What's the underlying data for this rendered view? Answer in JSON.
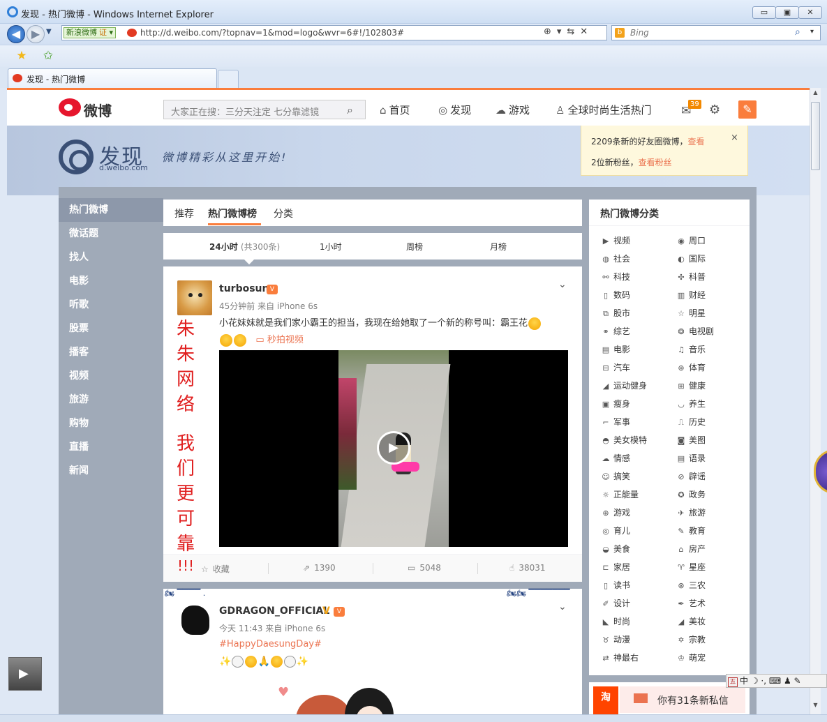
{
  "window": {
    "title": "发现 - 热门微博 - Windows Internet Explorer",
    "controls": {
      "minimize": "▭",
      "restore": "▣",
      "close": "✕"
    }
  },
  "address": {
    "site_tag": "新浪微博",
    "site_tag_cert": "证",
    "url": "http://d.weibo.com/?topnav=1&mod=logo&wvr=6#!/102803#",
    "icons": "⊕▾⇆✕"
  },
  "search": {
    "engine": "Bing",
    "go": "⌕",
    "menu": "▾"
  },
  "tabs": [
    {
      "label": "发现 - 热门微博"
    }
  ],
  "weibo": {
    "logo_text": "微博",
    "search_placeholder": "大家正在搜：三分天注定 七分靠滤镜",
    "nav": [
      {
        "label": "首页",
        "icon": "home-icon"
      },
      {
        "label": "发现",
        "icon": "compass-icon"
      },
      {
        "label": "游戏",
        "icon": "gamepad-icon"
      },
      {
        "label": "全球时尚生活热门",
        "icon": "user-icon"
      }
    ],
    "mail_count": "39"
  },
  "banner": {
    "title": "发现",
    "url": "d.weibo.com",
    "slogan": "微博精彩从这里开始!"
  },
  "notice": {
    "line1": "2209条新的好友圈微博，",
    "line1_link": "查看",
    "line2": "2位新粉丝，",
    "line2_link": "查看粉丝",
    "close": "×"
  },
  "left_nav": [
    {
      "label": "热门微博",
      "active": true
    },
    {
      "label": "微话题"
    },
    {
      "label": "找人"
    },
    {
      "label": "电影"
    },
    {
      "label": "听歌"
    },
    {
      "label": "股票"
    },
    {
      "label": "播客"
    },
    {
      "label": "视频"
    },
    {
      "label": "旅游"
    },
    {
      "label": "购物"
    },
    {
      "label": "直播"
    },
    {
      "label": "新闻"
    }
  ],
  "main_tabs": [
    {
      "label": "推荐"
    },
    {
      "label": "热门微博榜",
      "selected": true
    },
    {
      "label": "分类"
    }
  ],
  "rank_tabs": [
    {
      "label": "24小时",
      "count": "(共300条)",
      "selected": true
    },
    {
      "label": "1小时"
    },
    {
      "label": "周榜"
    },
    {
      "label": "月榜"
    }
  ],
  "post1": {
    "user": "turbosun",
    "meta": "45分钟前 来自 iPhone 6s",
    "text": "小花妹妹就是我们家小霸王的担当，我现在给她取了一个新的称号叫：霸王花",
    "video_link": "秒拍视频",
    "actions": [
      {
        "icon": "star-icon",
        "label": "收藏"
      },
      {
        "icon": "share-icon",
        "label": "1390"
      },
      {
        "icon": "comment-icon",
        "label": "5048"
      },
      {
        "icon": "like-icon",
        "label": "38031"
      }
    ]
  },
  "post2": {
    "user": "GDRAGON_OFFICIAL",
    "meta": "今天 11:43 来自 iPhone 6s",
    "tag": "#HappyDaesungDay#"
  },
  "overlay_text": {
    "line1": [
      "朱",
      "朱",
      "网",
      "络"
    ],
    "line2": [
      "我",
      "们",
      "更",
      "可",
      "靠"
    ],
    "bang": "!!!"
  },
  "right_panel": {
    "title": "热门微博分类",
    "categories": [
      {
        "label": "视频",
        "icon": "play-icon",
        "glyph": "▶"
      },
      {
        "label": "周口",
        "icon": "pin-icon",
        "glyph": "◉"
      },
      {
        "label": "社会",
        "icon": "globe-icon",
        "glyph": "◍"
      },
      {
        "label": "国际",
        "icon": "earth-icon",
        "glyph": "◐"
      },
      {
        "label": "科技",
        "icon": "link-icon",
        "glyph": "⚯"
      },
      {
        "label": "科普",
        "icon": "atom-icon",
        "glyph": "✣"
      },
      {
        "label": "数码",
        "icon": "device-icon",
        "glyph": "▯"
      },
      {
        "label": "财经",
        "icon": "bars-icon",
        "glyph": "▥"
      },
      {
        "label": "股市",
        "icon": "chart-icon",
        "glyph": "⧉"
      },
      {
        "label": "明星",
        "icon": "star-icon",
        "glyph": "☆"
      },
      {
        "label": "综艺",
        "icon": "mask-icon",
        "glyph": "⚭"
      },
      {
        "label": "电视剧",
        "icon": "film-reel-icon",
        "glyph": "❂"
      },
      {
        "label": "电影",
        "icon": "clapper-icon",
        "glyph": "▤"
      },
      {
        "label": "音乐",
        "icon": "music-icon",
        "glyph": "♫"
      },
      {
        "label": "汽车",
        "icon": "car-icon",
        "glyph": "⊟"
      },
      {
        "label": "体育",
        "icon": "ball-icon",
        "glyph": "⊛"
      },
      {
        "label": "运动健身",
        "icon": "shoe-icon",
        "glyph": "◢"
      },
      {
        "label": "健康",
        "icon": "medkit-icon",
        "glyph": "⊞"
      },
      {
        "label": "瘦身",
        "icon": "scale-icon",
        "glyph": "▣"
      },
      {
        "label": "养生",
        "icon": "bowl-icon",
        "glyph": "◡"
      },
      {
        "label": "军事",
        "icon": "gun-icon",
        "glyph": "⌐"
      },
      {
        "label": "历史",
        "icon": "scroll-icon",
        "glyph": "⎍"
      },
      {
        "label": "美女模特",
        "icon": "eye-icon",
        "glyph": "◓"
      },
      {
        "label": "美图",
        "icon": "camera-icon",
        "glyph": "◙"
      },
      {
        "label": "情感",
        "icon": "cloud-icon",
        "glyph": "☁"
      },
      {
        "label": "语录",
        "icon": "quote-icon",
        "glyph": "▤"
      },
      {
        "label": "搞笑",
        "icon": "smile-icon",
        "glyph": "☺"
      },
      {
        "label": "辟谣",
        "icon": "ban-icon",
        "glyph": "⊘"
      },
      {
        "label": "正能量",
        "icon": "sun-icon",
        "glyph": "☼"
      },
      {
        "label": "政务",
        "icon": "emblem-icon",
        "glyph": "✪"
      },
      {
        "label": "游戏",
        "icon": "gamepad-icon",
        "glyph": "⊕"
      },
      {
        "label": "旅游",
        "icon": "plane-icon",
        "glyph": "✈"
      },
      {
        "label": "育儿",
        "icon": "baby-icon",
        "glyph": "◎"
      },
      {
        "label": "教育",
        "icon": "pencil-icon",
        "glyph": "✎"
      },
      {
        "label": "美食",
        "icon": "dish-icon",
        "glyph": "◒"
      },
      {
        "label": "房产",
        "icon": "building-icon",
        "glyph": "⌂"
      },
      {
        "label": "家居",
        "icon": "sofa-icon",
        "glyph": "⊏"
      },
      {
        "label": "星座",
        "icon": "aries-icon",
        "glyph": "♈"
      },
      {
        "label": "读书",
        "icon": "book-icon",
        "glyph": "▯"
      },
      {
        "label": "三农",
        "icon": "tractor-icon",
        "glyph": "⊗"
      },
      {
        "label": "设计",
        "icon": "ruler-icon",
        "glyph": "✐"
      },
      {
        "label": "艺术",
        "icon": "brush-icon",
        "glyph": "✒"
      },
      {
        "label": "时尚",
        "icon": "heel-icon",
        "glyph": "◣"
      },
      {
        "label": "美妆",
        "icon": "lipstick-icon",
        "glyph": "◢"
      },
      {
        "label": "动漫",
        "icon": "anime-icon",
        "glyph": "♉"
      },
      {
        "label": "宗教",
        "icon": "dharma-icon",
        "glyph": "✡"
      },
      {
        "label": "神最右",
        "icon": "arrows-icon",
        "glyph": "⇄"
      },
      {
        "label": "萌宠",
        "icon": "crown-icon",
        "glyph": "♔"
      }
    ]
  },
  "taobao_tile": "淘",
  "message_popup": "你有31条新私信",
  "ime": {
    "box": "五",
    "text": "中 ☽ ·, ⌨ ♟ ✎"
  }
}
